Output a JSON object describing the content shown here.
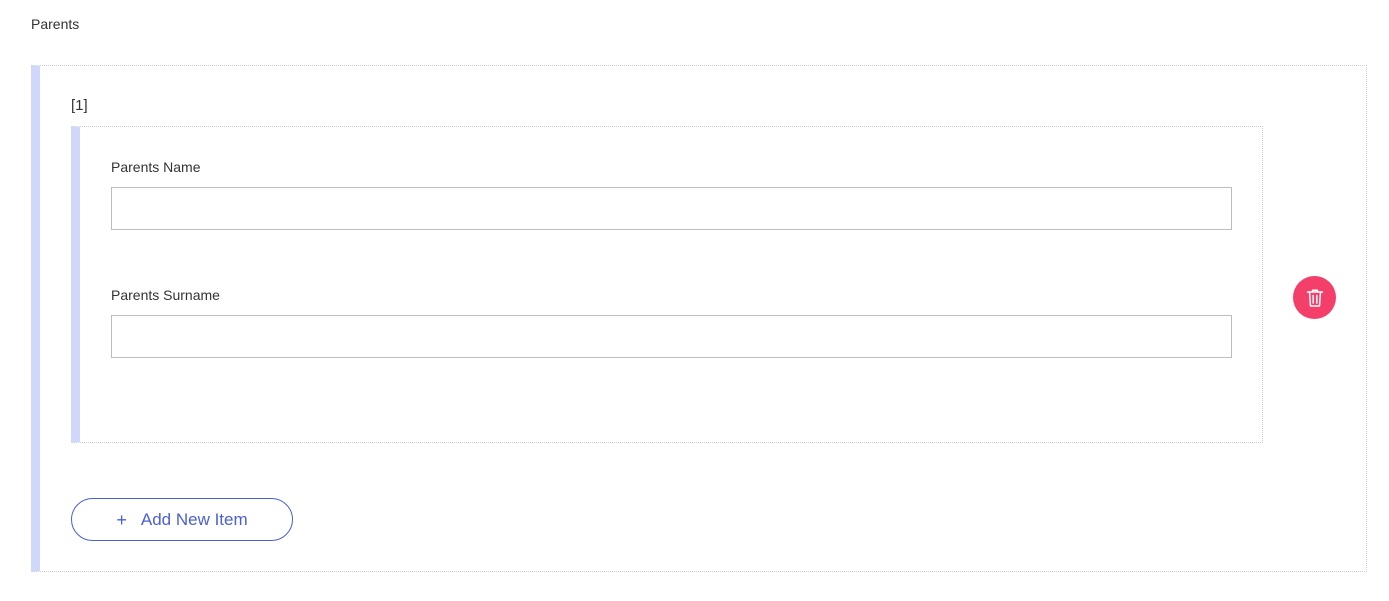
{
  "section": {
    "title": "Parents"
  },
  "items": [
    {
      "index_label": "[1]",
      "fields": {
        "name_label": "Parents Name",
        "name_value": "",
        "surname_label": "Parents Surname",
        "surname_value": ""
      }
    }
  ],
  "actions": {
    "add_label": "Add New Item",
    "add_icon": "plus-icon",
    "delete_icon": "trash-icon"
  },
  "colors": {
    "accent": "#4a5fd6",
    "delete": "#f43f6b",
    "group_border": "#cfd8fa"
  }
}
